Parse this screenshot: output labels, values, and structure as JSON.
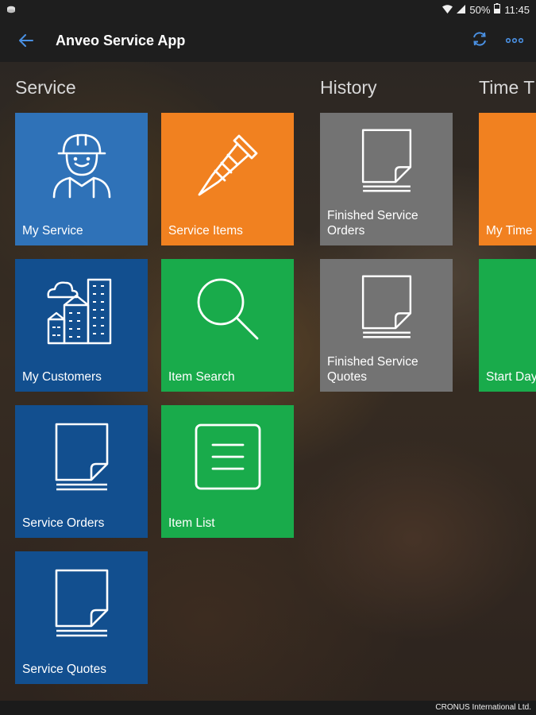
{
  "status_bar": {
    "battery": "50%",
    "time": "11:45"
  },
  "app_bar": {
    "title": "Anveo Service App"
  },
  "sections": {
    "service": "Service",
    "history": "History",
    "time": "Time T"
  },
  "tiles": {
    "my_service": "My Service",
    "service_items": "Service Items",
    "my_customers": "My Customers",
    "item_search": "Item Search",
    "service_orders": "Service Orders",
    "item_list": "Item List",
    "service_quotes": "Service Quotes",
    "finished_orders_1": "Finished Service",
    "finished_orders_2": "Orders",
    "finished_quotes_1": "Finished Service",
    "finished_quotes_2": "Quotes",
    "my_time": "My Time",
    "start_day": "Start Day"
  },
  "footer": {
    "company": "CRONUS International Ltd."
  },
  "colors": {
    "blue_light": "#2f72b8",
    "blue_dark": "#124f8f",
    "orange": "#f18120",
    "green": "#19ab4b",
    "gray": "#737373",
    "appbar_accent": "#4a90e2"
  }
}
